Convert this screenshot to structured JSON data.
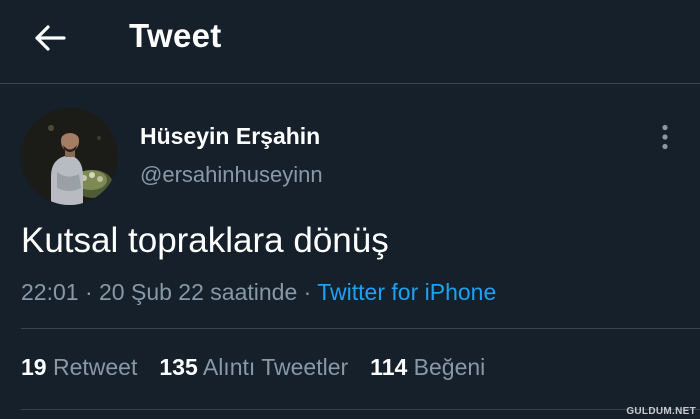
{
  "header": {
    "back_icon": "arrow-left-icon",
    "title": "Tweet"
  },
  "tweet": {
    "author": {
      "display_name": "Hüseyin Erşahin",
      "handle": "@ersahinhuseyinn",
      "avatar_icon": "profile-photo"
    },
    "more_icon": "more-vertical-icon",
    "text": "Kutsal topraklara dönüş",
    "time": "22:01",
    "separator1": " · ",
    "date": "20 Şub 22 saatinde",
    "separator2": " · ",
    "source": "Twitter for iPhone"
  },
  "stats": {
    "retweets": {
      "count": "19",
      "label": "Retweet"
    },
    "quotes": {
      "count": "135",
      "label": "Alıntı Tweetler"
    },
    "likes": {
      "count": "114",
      "label": "Beğeni"
    }
  },
  "watermark": "GULDUM.NET",
  "colors": {
    "background": "#15202b",
    "border": "#38444d",
    "secondary_text": "#8899a6",
    "link": "#1da1f2"
  }
}
